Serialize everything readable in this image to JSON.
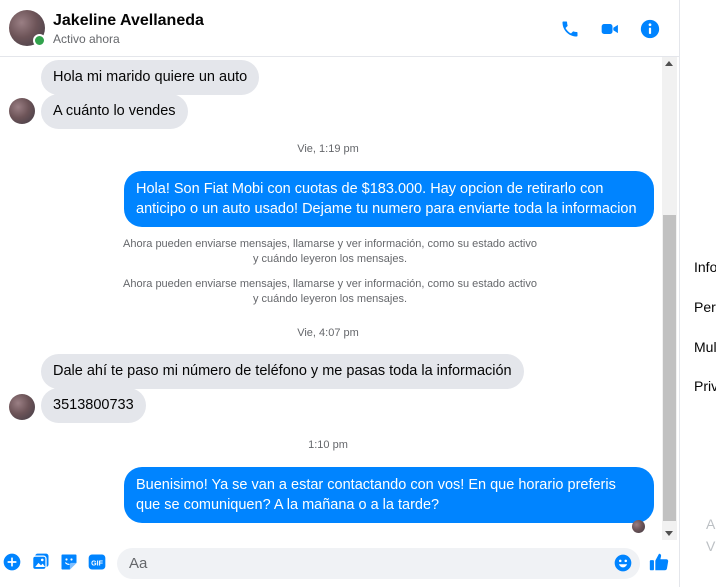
{
  "header": {
    "name": "Jakeline Avellaneda",
    "status": "Activo ahora",
    "icons": [
      "phone-icon",
      "video-camera-icon",
      "info-icon"
    ]
  },
  "messages": {
    "in_1": "Hola mi marido quiere un auto",
    "in_2": "A cuánto lo vendes",
    "stamp_1": "Vie, 1:19 pm",
    "out_1": "Hola! Son Fiat Mobi con cuotas de $183.000. Hay opcion de retirarlo con anticipo o un auto usado! Dejame tu numero para enviarte toda la informacion",
    "sys_1_line1": "Ahora pueden enviarse mensajes, llamarse y ver información, como su estado activo",
    "sys_1_line2": "y cuándo leyeron los mensajes.",
    "sys_2_line1": "Ahora pueden enviarse mensajes, llamarse y ver información, como su estado activo",
    "sys_2_line2": "y cuándo leyeron los mensajes.",
    "stamp_2": "Vie, 4:07 pm",
    "in_3": "Dale ahí te paso mi número de teléfono y me pasas toda la información",
    "in_4": "3513800733",
    "stamp_3": "1:10 pm",
    "out_2": "Buenisimo! Ya se van a estar contactando con vos! En que horario preferis que se comuniquen? A la mañana o a la tarde?"
  },
  "right_panel": {
    "items": [
      "Info",
      "Pers",
      "Mul",
      "Priv"
    ],
    "faint": [
      "A",
      "V"
    ]
  },
  "composer": {
    "placeholder": "Aa",
    "icons": [
      "plus-circle-icon",
      "image-icon",
      "sticker-icon",
      "gif-icon",
      "emoji-icon",
      "thumbs-up-icon"
    ]
  },
  "colors": {
    "accent": "#0084ff",
    "incoming_bubble": "#e4e6eb",
    "online": "#31a24c"
  }
}
